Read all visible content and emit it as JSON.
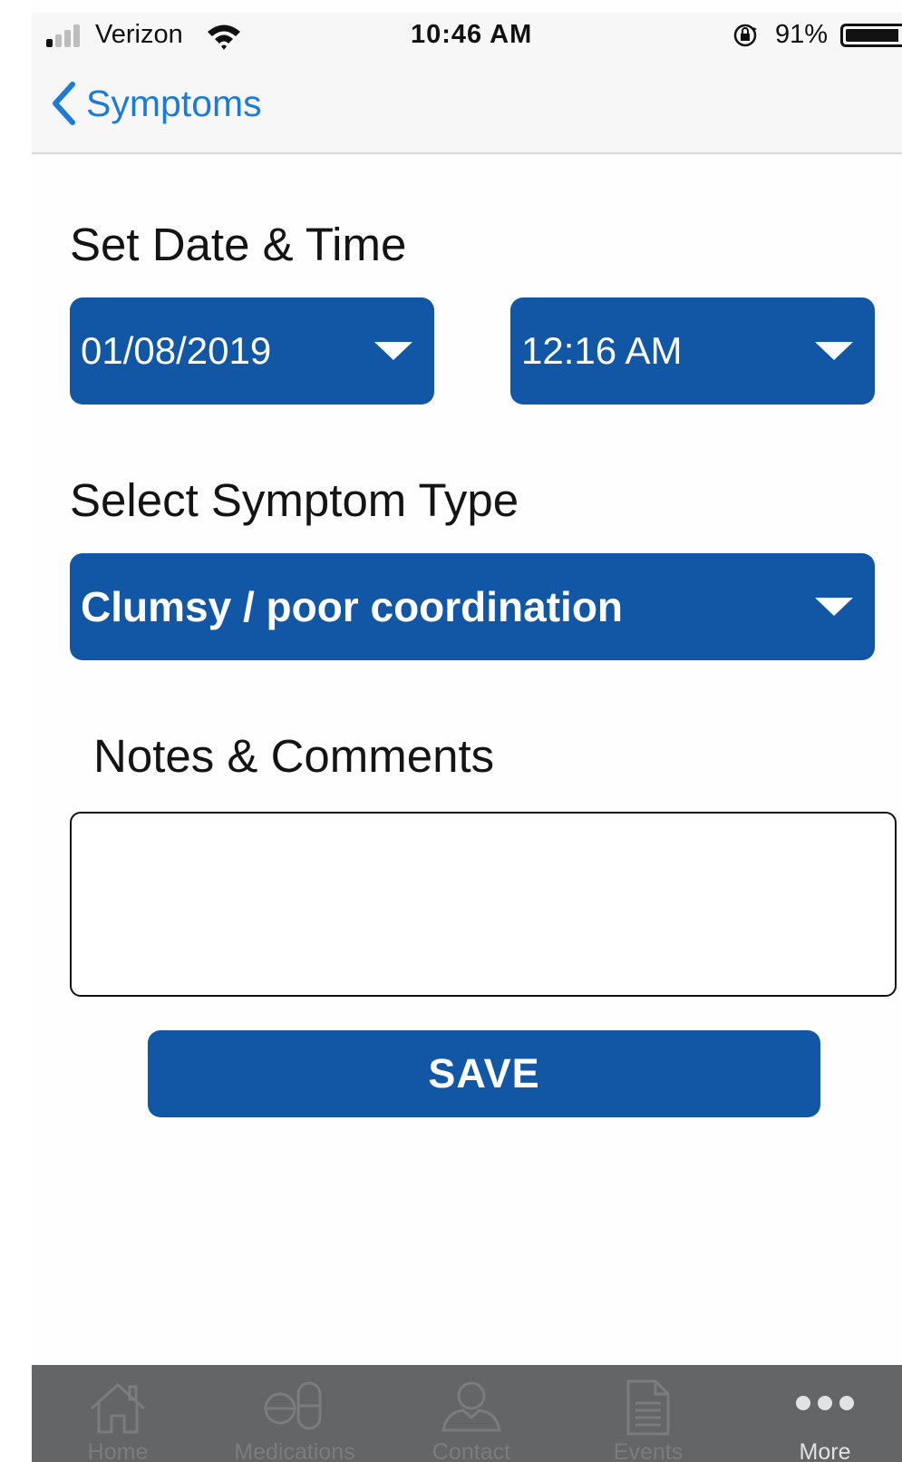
{
  "status_bar": {
    "carrier": "Verizon",
    "time": "10:46 AM",
    "battery_percent": "91%",
    "battery_level": 0.91,
    "signal_bars_filled": 1,
    "signal_bars_total": 4
  },
  "nav": {
    "back_label": "Symptoms"
  },
  "date_time": {
    "title": "Set Date & Time",
    "date_value": "01/08/2019",
    "time_value": "12:16 AM"
  },
  "symptom": {
    "title": "Select Symptom Type",
    "selected_value": "Clumsy / poor coordination"
  },
  "notes": {
    "title": "Notes & Comments",
    "value": ""
  },
  "save": {
    "label": "SAVE"
  },
  "tabs": [
    {
      "label": "Home",
      "icon": "home-icon",
      "active": false
    },
    {
      "label": "Medications",
      "icon": "pill-icon",
      "active": false
    },
    {
      "label": "Contact",
      "icon": "person-icon",
      "active": false
    },
    {
      "label": "Events",
      "icon": "document-icon",
      "active": false
    },
    {
      "label": "More",
      "icon": "more-dots-icon",
      "active": true
    }
  ],
  "colors": {
    "primary_blue": "#1157a6",
    "link_blue": "#1c7cd5",
    "tabbar_bg": "#646567",
    "tab_inactive": "#7b7c7e",
    "tab_active": "#e2e2e2"
  }
}
